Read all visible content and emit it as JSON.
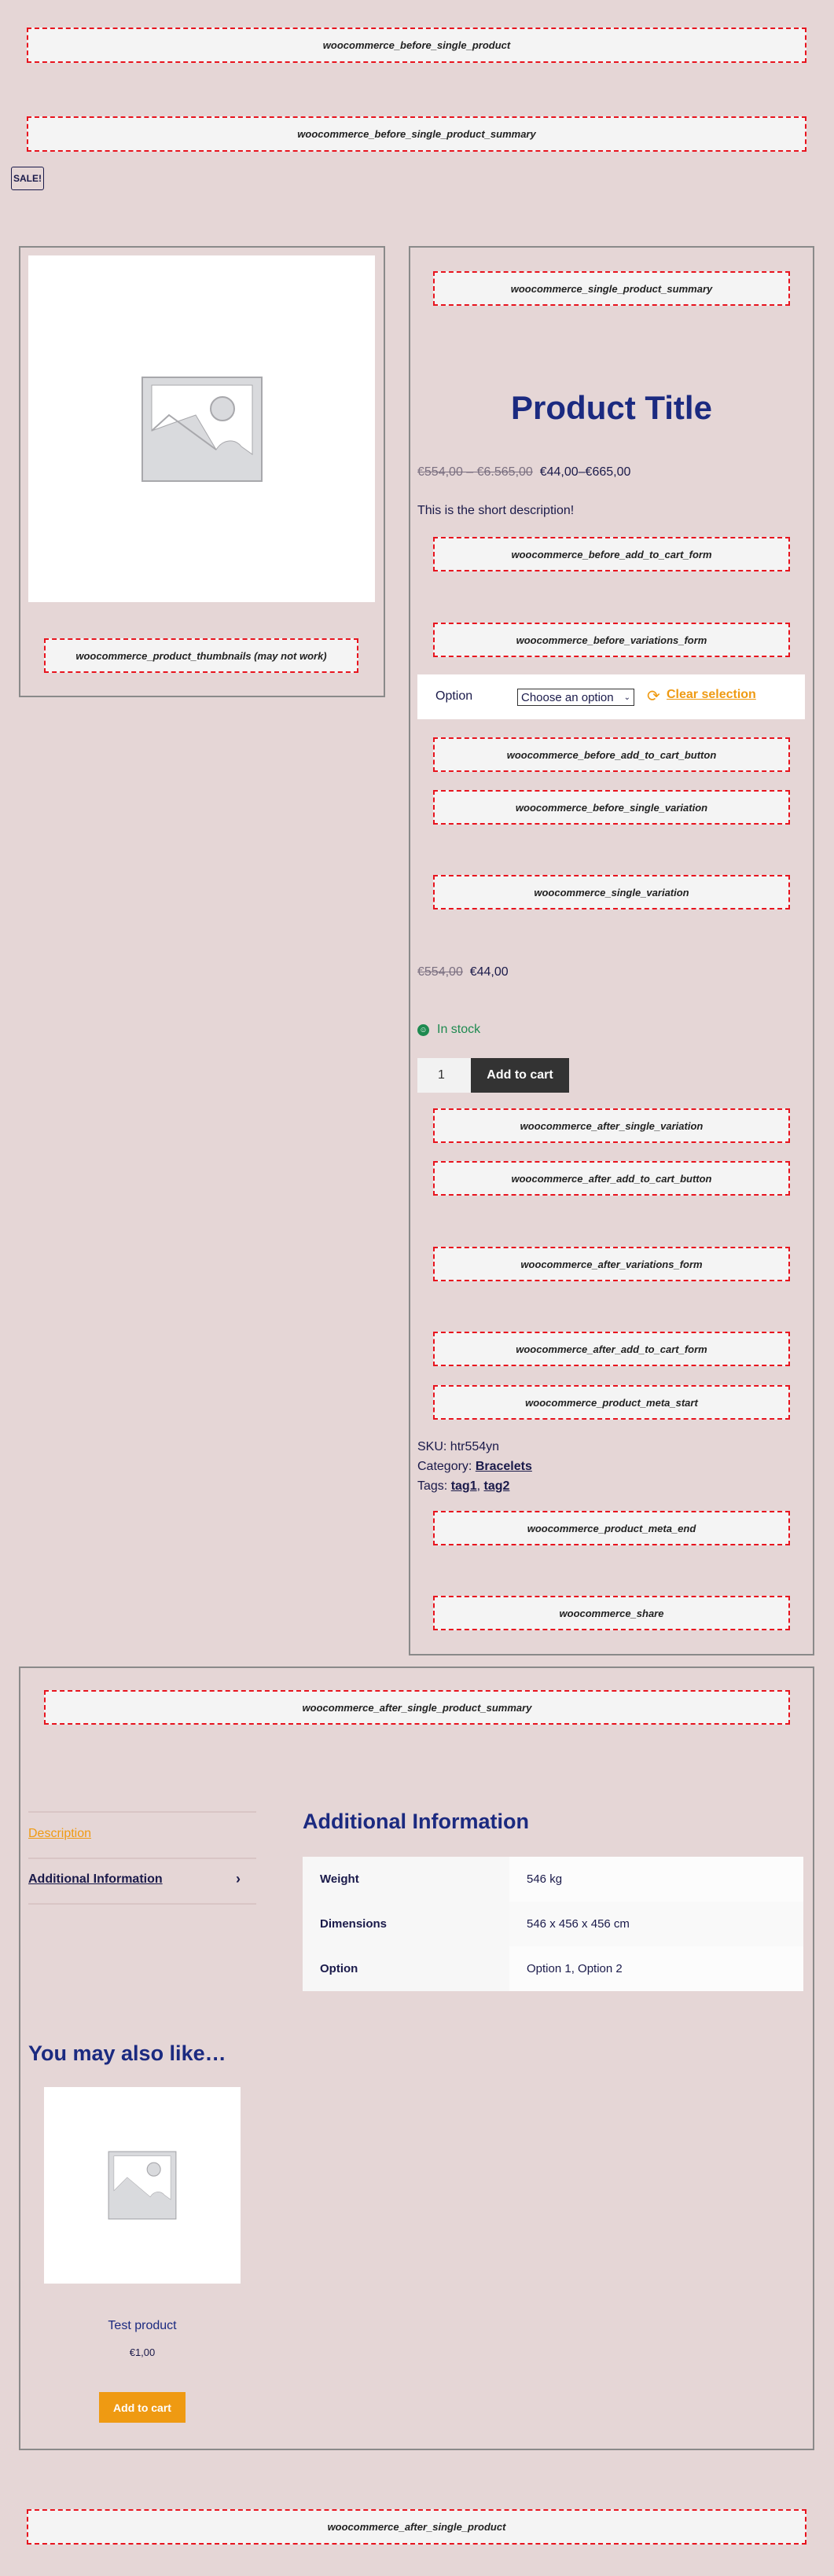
{
  "hooks": {
    "before_single_product": "woocommerce_before_single_product",
    "before_single_product_summary": "woocommerce_before_single_product_summary",
    "product_thumbnails": "woocommerce_product_thumbnails (may not work)",
    "single_product_summary": "woocommerce_single_product_summary",
    "before_add_to_cart_form": "woocommerce_before_add_to_cart_form",
    "before_variations_form": "woocommerce_before_variations_form",
    "before_add_to_cart_button": "woocommerce_before_add_to_cart_button",
    "before_single_variation": "woocommerce_before_single_variation",
    "single_variation": "woocommerce_single_variation",
    "after_single_variation": "woocommerce_after_single_variation",
    "after_add_to_cart_button": "woocommerce_after_add_to_cart_button",
    "after_variations_form": "woocommerce_after_variations_form",
    "after_add_to_cart_form": "woocommerce_after_add_to_cart_form",
    "product_meta_start": "woocommerce_product_meta_start",
    "product_meta_end": "woocommerce_product_meta_end",
    "share": "woocommerce_share",
    "after_single_product_summary": "woocommerce_after_single_product_summary",
    "after_single_product": "woocommerce_after_single_product"
  },
  "sale_badge": "SALE!",
  "product": {
    "title": "Product Title",
    "price_old": "€554,00 – €6.565,00",
    "price_new": "€44,00–€665,00",
    "short_description": "This is the short description!",
    "option_label": "Option",
    "option_select": "Choose an option",
    "clear_selection": "Clear selection",
    "variation_price_old": "€554,00",
    "variation_price_new": "€44,00",
    "stock": "In stock",
    "quantity": "1",
    "add_to_cart": "Add to cart",
    "sku_label": "SKU:",
    "sku": "htr554yn",
    "category_label": "Category:",
    "category": "Bracelets",
    "tags_label": "Tags:",
    "tags": [
      "tag1",
      "tag2"
    ],
    "tag_separator": ","
  },
  "tabs": [
    {
      "label": "Description",
      "active": false
    },
    {
      "label": "Additional Information",
      "active": true
    }
  ],
  "additional_info": {
    "heading": "Additional Information",
    "rows": [
      {
        "label": "Weight",
        "value": "546 kg"
      },
      {
        "label": "Dimensions",
        "value": "546 x 456 x 456 cm"
      },
      {
        "label": "Option",
        "value": "Option 1, Option 2"
      }
    ]
  },
  "related": {
    "heading": "You may also like…",
    "products": [
      {
        "name": "Test product",
        "price": "€1,00",
        "button": "Add to cart"
      }
    ]
  },
  "colors": {
    "background": "#e5d6d6",
    "title": "#1b2a80",
    "accent": "#ef9a12",
    "hook_border": "#e8141e",
    "stock": "#1e8a50",
    "button_dark": "#333333"
  }
}
